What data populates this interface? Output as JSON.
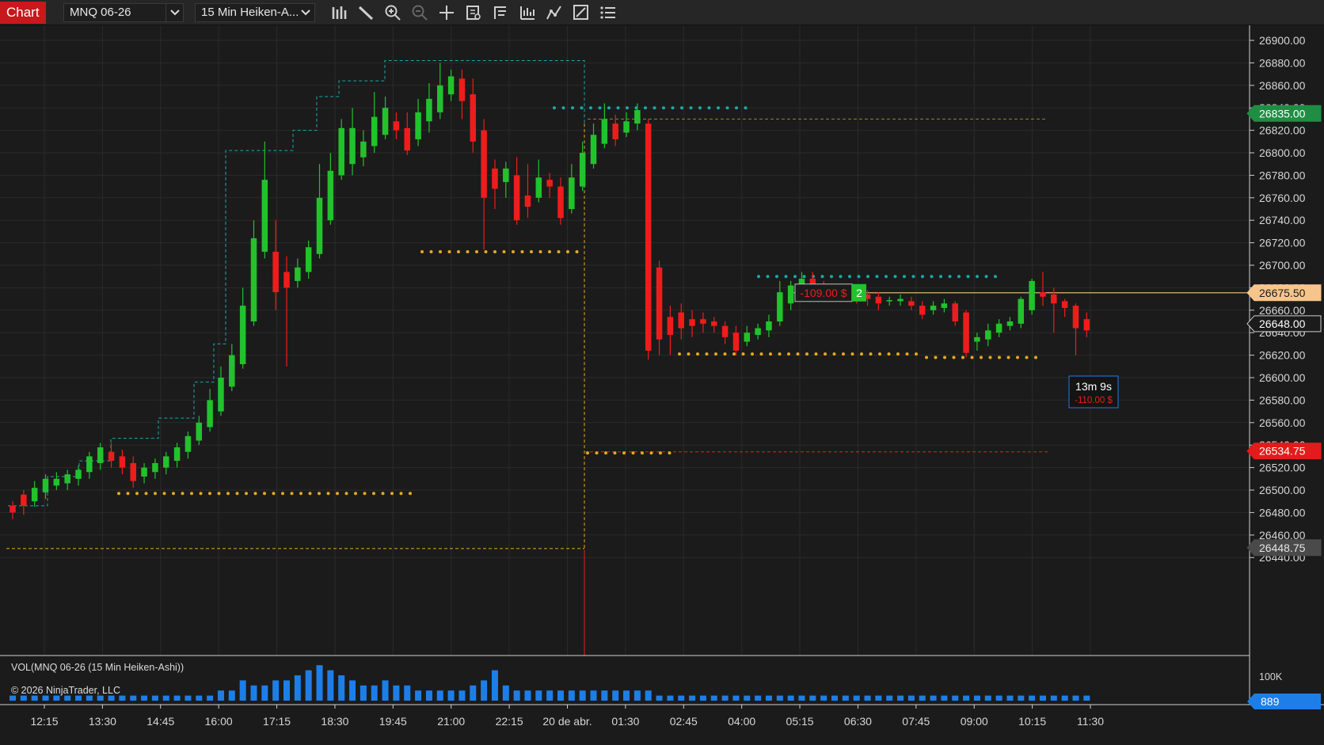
{
  "toolbar": {
    "chart_tab": "Chart",
    "instrument": "MNQ 06-26",
    "timeframe": "15 Min Heiken-A...",
    "tools": [
      "bar-type-icon",
      "pencil-draw-icon",
      "zoom-in-icon",
      "zoom-out-icon",
      "crosshair-icon",
      "data-box-icon",
      "range-icon",
      "indicators-icon",
      "strategies-icon",
      "chart-properties-icon",
      "object-list-icon"
    ]
  },
  "chart_data": {
    "type": "candlestick",
    "instrument": "MNQ 06-26",
    "bar_type": "15 Min Heiken-Ashi",
    "price_axis": {
      "ylim": [
        26430,
        26910
      ],
      "ticks": [
        "26900.00",
        "26880.00",
        "26860.00",
        "26840.00",
        "26820.00",
        "26800.00",
        "26780.00",
        "26760.00",
        "26740.00",
        "26720.00",
        "26700.00",
        "26680.00",
        "26660.00",
        "26640.00",
        "26620.00",
        "26600.00",
        "26580.00",
        "26560.00",
        "26540.00",
        "26520.00",
        "26500.00",
        "26480.00",
        "26460.00",
        "26440.00"
      ],
      "tick_values": [
        26900,
        26880,
        26860,
        26840,
        26820,
        26800,
        26780,
        26760,
        26740,
        26720,
        26700,
        26680,
        26660,
        26640,
        26620,
        26600,
        26580,
        26560,
        26540,
        26520,
        26500,
        26480,
        26460,
        26440
      ]
    },
    "time_axis": {
      "labels": [
        "12:15",
        "13:30",
        "14:45",
        "16:00",
        "17:15",
        "18:30",
        "19:45",
        "21:00",
        "22:15",
        "20 de abr.",
        "01:30",
        "02:45",
        "04:00",
        "05:15",
        "06:30",
        "07:45",
        "09:00",
        "10:15",
        "11:30"
      ]
    },
    "candles": [
      [
        0,
        26480,
        26486,
        26474,
        26490
      ],
      [
        0,
        26486,
        26496,
        26478,
        26500
      ],
      [
        1,
        26490,
        26502,
        26485,
        26508
      ],
      [
        1,
        26498,
        26510,
        26492,
        26514
      ],
      [
        1,
        26504,
        26510,
        26500,
        26516
      ],
      [
        1,
        26506,
        26514,
        26500,
        26518
      ],
      [
        1,
        26510,
        26518,
        26504,
        26522
      ],
      [
        1,
        26516,
        26530,
        26510,
        26534
      ],
      [
        1,
        26524,
        26538,
        26518,
        26542
      ],
      [
        0,
        26534,
        26526,
        26520,
        26542
      ],
      [
        0,
        26530,
        26520,
        26514,
        26536
      ],
      [
        0,
        26524,
        26508,
        26502,
        26530
      ],
      [
        1,
        26512,
        26520,
        26506,
        26524
      ],
      [
        1,
        26516,
        26524,
        26510,
        26528
      ],
      [
        1,
        26520,
        26530,
        26514,
        26534
      ],
      [
        1,
        26526,
        26538,
        26520,
        26542
      ],
      [
        1,
        26534,
        26548,
        26528,
        26552
      ],
      [
        1,
        26544,
        26560,
        26540,
        26566
      ],
      [
        1,
        26556,
        26580,
        26552,
        26590
      ],
      [
        1,
        26570,
        26600,
        26566,
        26610
      ],
      [
        1,
        26592,
        26620,
        26588,
        26630
      ],
      [
        1,
        26612,
        26664,
        26608,
        26680
      ],
      [
        1,
        26650,
        26724,
        26646,
        26740
      ],
      [
        1,
        26712,
        26776,
        26706,
        26810
      ],
      [
        0,
        26712,
        26676,
        26660,
        26740
      ],
      [
        0,
        26694,
        26680,
        26610,
        26708
      ],
      [
        1,
        26686,
        26698,
        26680,
        26706
      ],
      [
        1,
        26694,
        26716,
        26688,
        26722
      ],
      [
        1,
        26710,
        26760,
        26706,
        26790
      ],
      [
        1,
        26740,
        26784,
        26736,
        26800
      ],
      [
        1,
        26780,
        26822,
        26776,
        26830
      ],
      [
        1,
        26790,
        26822,
        26780,
        26840
      ],
      [
        1,
        26796,
        26810,
        26788,
        26820
      ],
      [
        1,
        26806,
        26832,
        26800,
        26854
      ],
      [
        1,
        26816,
        26840,
        26812,
        26850
      ],
      [
        0,
        26828,
        26820,
        26812,
        26836
      ],
      [
        0,
        26822,
        26802,
        26798,
        26836
      ],
      [
        1,
        26812,
        26836,
        26806,
        26848
      ],
      [
        1,
        26828,
        26848,
        26818,
        26862
      ],
      [
        1,
        26836,
        26860,
        26830,
        26880
      ],
      [
        1,
        26852,
        26868,
        26846,
        26874
      ],
      [
        0,
        26866,
        26846,
        26830,
        26874
      ],
      [
        0,
        26852,
        26810,
        26800,
        26866
      ],
      [
        0,
        26820,
        26760,
        26714,
        26830
      ],
      [
        0,
        26786,
        26768,
        26750,
        26794
      ],
      [
        1,
        26774,
        26786,
        26760,
        26792
      ],
      [
        0,
        26780,
        26740,
        26736,
        26796
      ],
      [
        0,
        26762,
        26752,
        26742,
        26790
      ],
      [
        1,
        26760,
        26778,
        26756,
        26794
      ],
      [
        0,
        26776,
        26770,
        26760,
        26782
      ],
      [
        0,
        26770,
        26742,
        26736,
        26778
      ],
      [
        1,
        26750,
        26778,
        26746,
        26790
      ],
      [
        1,
        26770,
        26800,
        26766,
        26810
      ],
      [
        1,
        26790,
        26816,
        26786,
        26826
      ],
      [
        1,
        26808,
        26830,
        26804,
        26844
      ],
      [
        0,
        26826,
        26812,
        26806,
        26834
      ],
      [
        1,
        26818,
        26828,
        26814,
        26836
      ],
      [
        1,
        26826,
        26838,
        26820,
        26844
      ],
      [
        0,
        26826,
        26624,
        26616,
        26830
      ],
      [
        0,
        26698,
        26634,
        26620,
        26704
      ],
      [
        0,
        26654,
        26638,
        26620,
        26664
      ],
      [
        0,
        26658,
        26644,
        26634,
        26666
      ],
      [
        0,
        26652,
        26646,
        26636,
        26660
      ],
      [
        0,
        26652,
        26648,
        26640,
        26658
      ],
      [
        0,
        26650,
        26646,
        26640,
        26654
      ],
      [
        0,
        26646,
        26636,
        26630,
        26650
      ],
      [
        0,
        26640,
        26624,
        26620,
        26646
      ],
      [
        1,
        26632,
        26640,
        26628,
        26646
      ],
      [
        1,
        26638,
        26644,
        26634,
        26648
      ],
      [
        1,
        26642,
        26650,
        26636,
        26656
      ],
      [
        1,
        26650,
        26676,
        26646,
        26686
      ],
      [
        1,
        26666,
        26682,
        26660,
        26686
      ],
      [
        1,
        26676,
        26688,
        26670,
        26694
      ],
      [
        0,
        26688,
        26676,
        26674,
        26694
      ],
      [
        0,
        26682,
        26674,
        26672,
        26686
      ],
      [
        1,
        26674,
        26678,
        26670,
        26682
      ],
      [
        0,
        26676,
        26672,
        26670,
        26680
      ],
      [
        0,
        26674,
        26671,
        26666,
        26678
      ],
      [
        0,
        26674,
        26670,
        26664,
        26678
      ],
      [
        0,
        26672,
        26666,
        26660,
        26676
      ],
      [
        1,
        26668,
        26669,
        26664,
        26672
      ],
      [
        1,
        26668,
        26670,
        26664,
        26674
      ],
      [
        0,
        26668,
        26664,
        26660,
        26672
      ],
      [
        0,
        26664,
        26656,
        26652,
        26668
      ],
      [
        1,
        26660,
        26664,
        26656,
        26668
      ],
      [
        1,
        26662,
        26666,
        26658,
        26670
      ],
      [
        0,
        26666,
        26650,
        26646,
        26668
      ],
      [
        0,
        26658,
        26622,
        26618,
        26660
      ],
      [
        1,
        26632,
        26636,
        26624,
        26640
      ],
      [
        1,
        26634,
        26642,
        26628,
        26648
      ],
      [
        1,
        26640,
        26648,
        26636,
        26652
      ],
      [
        1,
        26646,
        26650,
        26642,
        26654
      ],
      [
        1,
        26648,
        26670,
        26644,
        26672
      ],
      [
        1,
        26660,
        26686,
        26656,
        26688
      ],
      [
        0,
        26676,
        26672,
        26664,
        26694
      ],
      [
        0,
        26674,
        26666,
        26640,
        26680
      ],
      [
        0,
        26668,
        26662,
        26654,
        26670
      ],
      [
        0,
        26664,
        26644,
        26620,
        26666
      ],
      [
        0,
        26652,
        26642,
        26636,
        26658
      ]
    ],
    "volume": [
      1,
      1,
      1,
      1,
      1,
      1,
      1,
      1,
      1,
      1,
      1,
      1,
      1,
      1,
      1,
      1,
      1,
      1,
      1,
      2,
      2,
      4,
      3,
      3,
      4,
      4,
      5,
      6,
      7,
      6,
      5,
      4,
      3,
      3,
      4,
      3,
      3,
      2,
      2,
      2,
      2,
      2,
      3,
      4,
      6,
      3,
      2,
      2,
      2,
      2,
      2,
      2,
      2,
      2,
      2,
      2,
      2,
      2,
      2,
      1,
      1,
      1,
      1,
      1,
      1,
      1,
      1,
      1,
      1,
      1,
      1,
      1,
      1,
      1,
      1,
      1,
      1,
      1,
      1,
      1,
      1,
      1,
      1,
      1,
      1,
      1,
      1,
      1,
      1,
      1,
      1,
      1,
      1,
      1,
      1,
      1,
      1,
      1,
      1
    ],
    "volume_label": "VOL(MNQ 06-26 (15 Min Heiken-Ashi))",
    "volume_axis_tick": "100K",
    "volume_last": "889",
    "copyright": "© 2026 NinjaTrader, LLC",
    "price_tags": {
      "high_level": "26835.00",
      "position_level": "26675.50",
      "last_price": "26648.00",
      "low_level": "26534.75",
      "bottom_level": "26448.75"
    },
    "position": {
      "pnl": "-109.00 $",
      "quantity": "2"
    },
    "bar_timer": {
      "time_left": "13m 9s",
      "pnl": "-110.00 $"
    },
    "colors": {
      "background": "#1b1b1b",
      "grid": "#2b2b2b",
      "up_candle": "#22c22c",
      "down_candle": "#ef1c1c",
      "volume": "#1d7ee8",
      "gold_dots": "#e7a81d",
      "teal_dots": "#1aa8a8",
      "position_line": "#f7c58b"
    }
  }
}
